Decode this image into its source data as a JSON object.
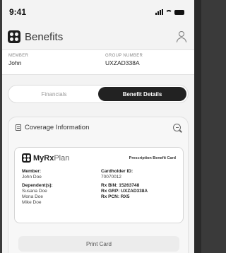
{
  "status": {
    "time": "9:41"
  },
  "header": {
    "title": "Benefits"
  },
  "member": {
    "member_label": "MEMBER",
    "member_value": "John",
    "group_label": "GROUP NUMBER",
    "group_value": "UXZAD338A"
  },
  "tabs": [
    {
      "label": "Financials",
      "active": false
    },
    {
      "label": "Benefit Details",
      "active": true
    }
  ],
  "coverage": {
    "title": "Coverage Information",
    "card": {
      "brand_bold": "MyRx",
      "brand_light": "Plan",
      "card_type": "Prescription Benefit Card",
      "member_key": "Member:",
      "member_val": "John Doe",
      "dependents_key": "Dependent(s):",
      "dependents": [
        "Susana Doe",
        "Mona Doe",
        "Mike Doe"
      ],
      "cardholder_key": "Cardholder ID:",
      "cardholder_val": "70070012",
      "bin": "Rx BIN: 15263748",
      "grp": "Rx GRP: UXZAD338A",
      "pcn": "Rx PCN: RX5"
    },
    "print_label": "Print Card"
  }
}
